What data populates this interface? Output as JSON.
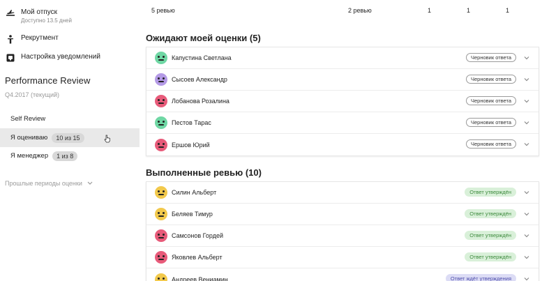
{
  "sidebar": {
    "vacation": {
      "label": "Мой отпуск",
      "sub": "Доступно 13.5 дней"
    },
    "recruitment": {
      "label": "Рекрутмент"
    },
    "notifications": {
      "label": "Настройка уведомлений"
    },
    "section_title": "Performance Review",
    "period": "Q4.2017 (текущий)",
    "menu": [
      {
        "label": "Self Review",
        "count": ""
      },
      {
        "label": "Я оцениваю",
        "count": "10 из 15"
      },
      {
        "label": "Я менеджер",
        "count": "1 из 8"
      }
    ],
    "past_periods": "Прошлые периоды оценки"
  },
  "summary": {
    "reviews": "5 ревью",
    "reviews2": "2 ревью",
    "c1": "1",
    "c2": "1",
    "c3": "1"
  },
  "groups": [
    {
      "title": "Ожидают моей оценки (5)",
      "rows": [
        {
          "name": "Капустина Светлана",
          "status": "Черновик ответа",
          "kind": "draft",
          "color": "#6fd7a4"
        },
        {
          "name": "Сысоев Александр",
          "status": "Черновик ответа",
          "kind": "draft",
          "color": "#b49ae6"
        },
        {
          "name": "Лобанова Розалина",
          "status": "Черновик ответа",
          "kind": "draft",
          "color": "#e85b7a"
        },
        {
          "name": "Пестов Тарас",
          "status": "Черновик ответа",
          "kind": "draft",
          "color": "#6fd7a4"
        },
        {
          "name": "Ершов Юрий",
          "status": "Черновик ответа",
          "kind": "draft",
          "color": "#e85b7a"
        }
      ]
    },
    {
      "title": "Выполненные ревью (10)",
      "rows": [
        {
          "name": "Силин Альберт",
          "status": "Ответ утверждён",
          "kind": "ok",
          "color": "#f2c94c"
        },
        {
          "name": "Беляев Тимур",
          "status": "Ответ утверждён",
          "kind": "ok",
          "color": "#f2c94c"
        },
        {
          "name": "Самсонов Гордей",
          "status": "Ответ утверждён",
          "kind": "ok",
          "color": "#e85b7a"
        },
        {
          "name": "Яковлев Альберт",
          "status": "Ответ утверждён",
          "kind": "ok",
          "color": "#e85b7a"
        },
        {
          "name": "Андреев Вениамин",
          "status": "Ответ ждёт утверждения",
          "kind": "wait",
          "color": "#f2c94c"
        }
      ]
    }
  ],
  "colors": {
    "draft_border": "#9a9a9a",
    "ok_bg": "#d9f0d9",
    "ok_text": "#3d8a3d",
    "wait_bg": "#dcdcf5",
    "wait_text": "#4d4dab",
    "active_menu_bg": "#e9e9e9"
  },
  "icons": {
    "vacation": "airplane-icon",
    "recruitment": "person-icon",
    "notifications": "notification-icon",
    "row_chevron": "chevron-down-icon",
    "past_chevron": "chevron-down-icon"
  }
}
